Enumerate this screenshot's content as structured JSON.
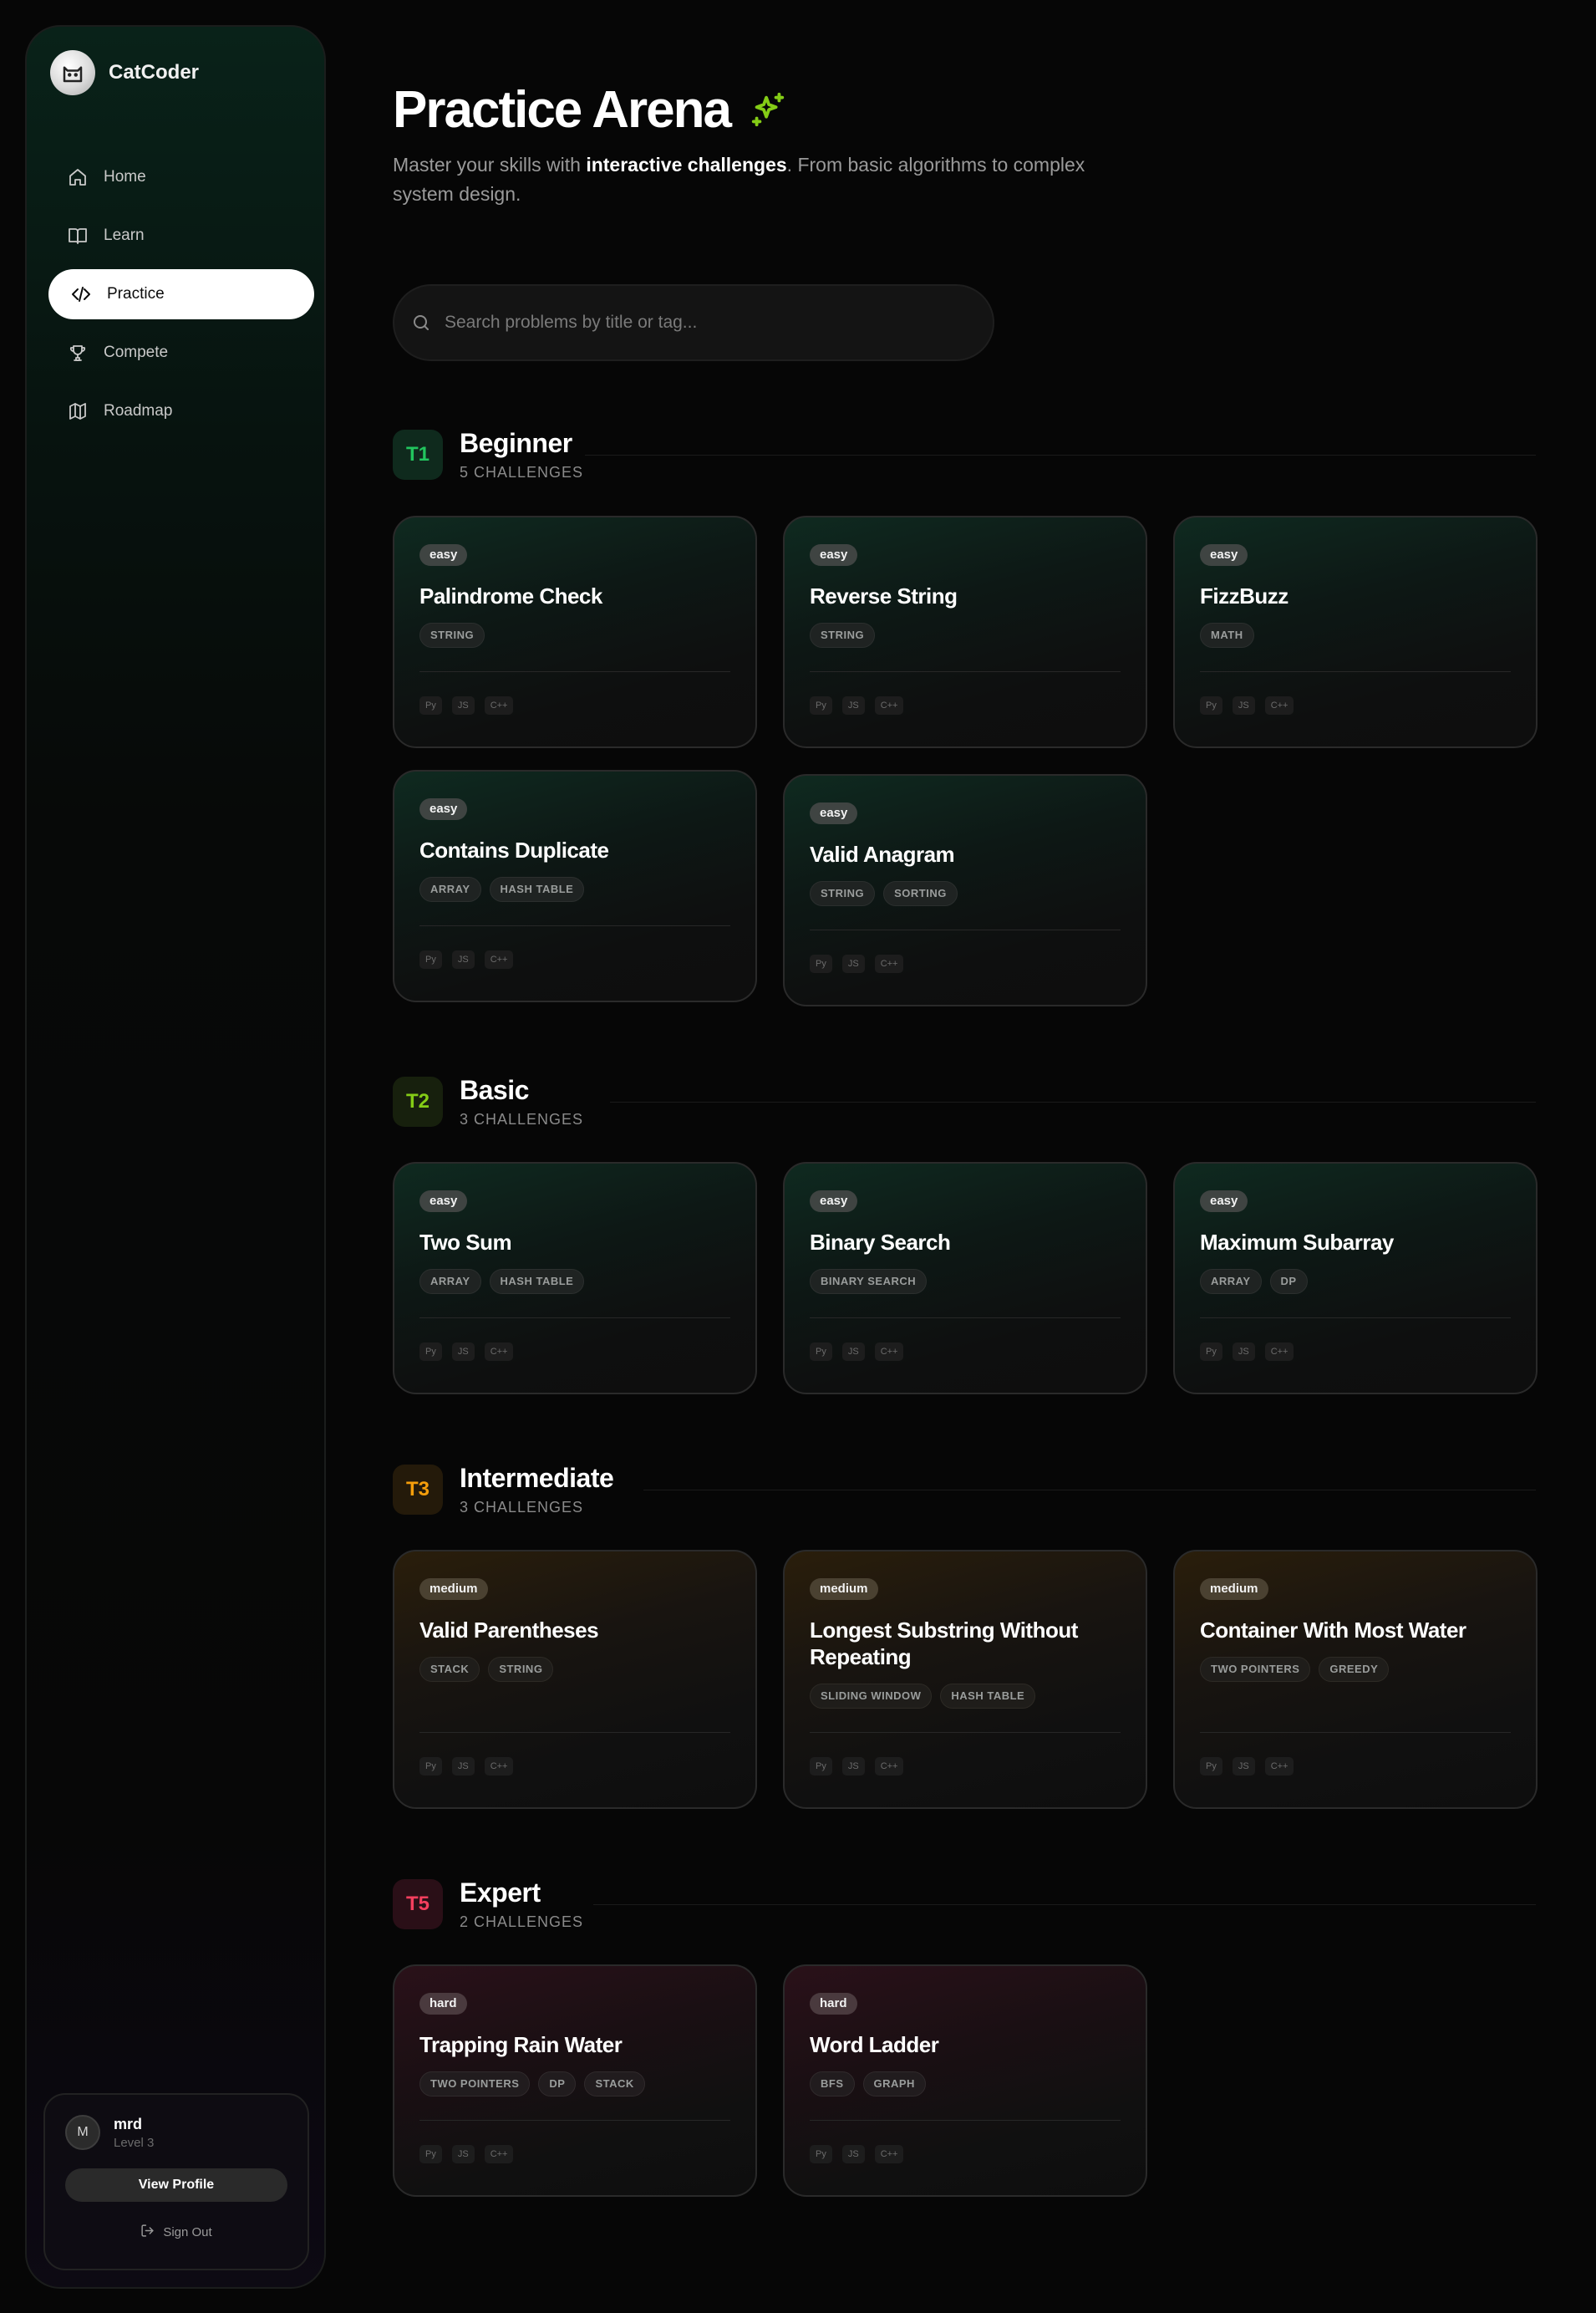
{
  "app": {
    "name": "CatCoder",
    "logo_icon": "cat-icon"
  },
  "nav": [
    {
      "label": "Home",
      "icon": "home-icon",
      "active": false
    },
    {
      "label": "Learn",
      "icon": "book-icon",
      "active": false
    },
    {
      "label": "Practice",
      "icon": "code-icon",
      "active": true
    },
    {
      "label": "Compete",
      "icon": "trophy-icon",
      "active": false
    },
    {
      "label": "Roadmap",
      "icon": "map-icon",
      "active": false
    }
  ],
  "user": {
    "initial": "M",
    "name": "mrd",
    "level": "Level 3",
    "view_profile": "View Profile",
    "sign_out": "Sign Out"
  },
  "header": {
    "title": "Practice Arena",
    "subtitle_pre": "Master your skills with ",
    "subtitle_bold": "interactive challenges",
    "subtitle_post": ". From basic algorithms to complex system design."
  },
  "search": {
    "placeholder": "Search problems by title or tag..."
  },
  "colors": {
    "accent_green": "#84cc16",
    "t1": "#22c55e",
    "t2": "#84cc16",
    "t3": "#f59e0b",
    "t5": "#f43f5e"
  },
  "tiers": [
    {
      "code": "T1",
      "name": "Beginner",
      "count": "5 CHALLENGES",
      "cards": [
        {
          "difficulty": "easy",
          "title": "Palindrome Check",
          "tags": [
            "STRING"
          ],
          "langs": [
            "Py",
            "JS",
            "C++"
          ]
        },
        {
          "difficulty": "easy",
          "title": "Reverse String",
          "tags": [
            "STRING"
          ],
          "langs": [
            "Py",
            "JS",
            "C++"
          ]
        },
        {
          "difficulty": "easy",
          "title": "FizzBuzz",
          "tags": [
            "MATH"
          ],
          "langs": [
            "Py",
            "JS",
            "C++"
          ]
        },
        {
          "difficulty": "easy",
          "title": "Contains Duplicate",
          "tags": [
            "ARRAY",
            "HASH TABLE"
          ],
          "langs": [
            "Py",
            "JS",
            "C++"
          ]
        },
        {
          "difficulty": "easy",
          "title": "Valid Anagram",
          "tags": [
            "STRING",
            "SORTING"
          ],
          "langs": [
            "Py",
            "JS",
            "C++"
          ]
        }
      ]
    },
    {
      "code": "T2",
      "name": "Basic",
      "count": "3 CHALLENGES",
      "cards": [
        {
          "difficulty": "easy",
          "title": "Two Sum",
          "tags": [
            "ARRAY",
            "HASH TABLE"
          ],
          "langs": [
            "Py",
            "JS",
            "C++"
          ]
        },
        {
          "difficulty": "easy",
          "title": "Binary Search",
          "tags": [
            "BINARY SEARCH"
          ],
          "langs": [
            "Py",
            "JS",
            "C++"
          ]
        },
        {
          "difficulty": "easy",
          "title": "Maximum Subarray",
          "tags": [
            "ARRAY",
            "DP"
          ],
          "langs": [
            "Py",
            "JS",
            "C++"
          ]
        }
      ]
    },
    {
      "code": "T3",
      "name": "Intermediate",
      "count": "3 CHALLENGES",
      "cards": [
        {
          "difficulty": "medium",
          "title": "Valid Parentheses",
          "tags": [
            "STACK",
            "STRING"
          ],
          "langs": [
            "Py",
            "JS",
            "C++"
          ]
        },
        {
          "difficulty": "medium",
          "title": "Longest Substring Without Repeating",
          "tags": [
            "SLIDING WINDOW",
            "HASH TABLE"
          ],
          "langs": [
            "Py",
            "JS",
            "C++"
          ]
        },
        {
          "difficulty": "medium",
          "title": "Container With Most Water",
          "tags": [
            "TWO POINTERS",
            "GREEDY"
          ],
          "langs": [
            "Py",
            "JS",
            "C++"
          ]
        }
      ]
    },
    {
      "code": "T5",
      "name": "Expert",
      "count": "2 CHALLENGES",
      "cards": [
        {
          "difficulty": "hard",
          "title": "Trapping Rain Water",
          "tags": [
            "TWO POINTERS",
            "DP",
            "STACK"
          ],
          "langs": [
            "Py",
            "JS",
            "C++"
          ]
        },
        {
          "difficulty": "hard",
          "title": "Word Ladder",
          "tags": [
            "BFS",
            "GRAPH"
          ],
          "langs": [
            "Py",
            "JS",
            "C++"
          ]
        }
      ]
    }
  ]
}
